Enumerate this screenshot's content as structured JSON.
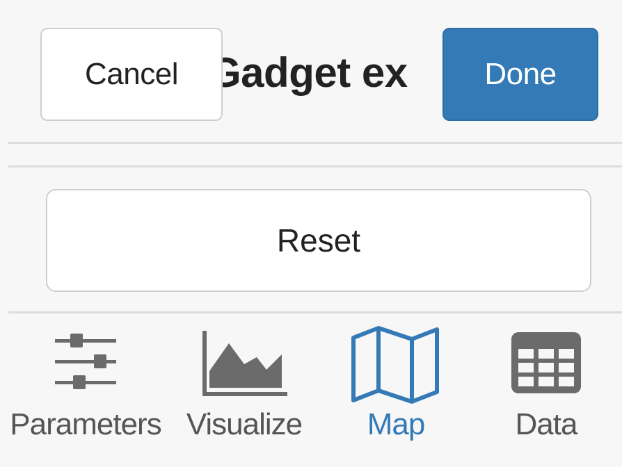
{
  "header": {
    "title": "Gadget ex",
    "cancel_label": "Cancel",
    "done_label": "Done"
  },
  "reset_label": "Reset",
  "tabs": [
    {
      "label": "Parameters",
      "icon": "sliders-icon",
      "active": false
    },
    {
      "label": "Visualize",
      "icon": "area-chart-icon",
      "active": false
    },
    {
      "label": "Map",
      "icon": "map-icon",
      "active": true
    },
    {
      "label": "Data",
      "icon": "table-icon",
      "active": false
    }
  ],
  "colors": {
    "accent": "#337ab7",
    "icon_gray": "#6b6b6b",
    "background": "#f7f7f7"
  }
}
